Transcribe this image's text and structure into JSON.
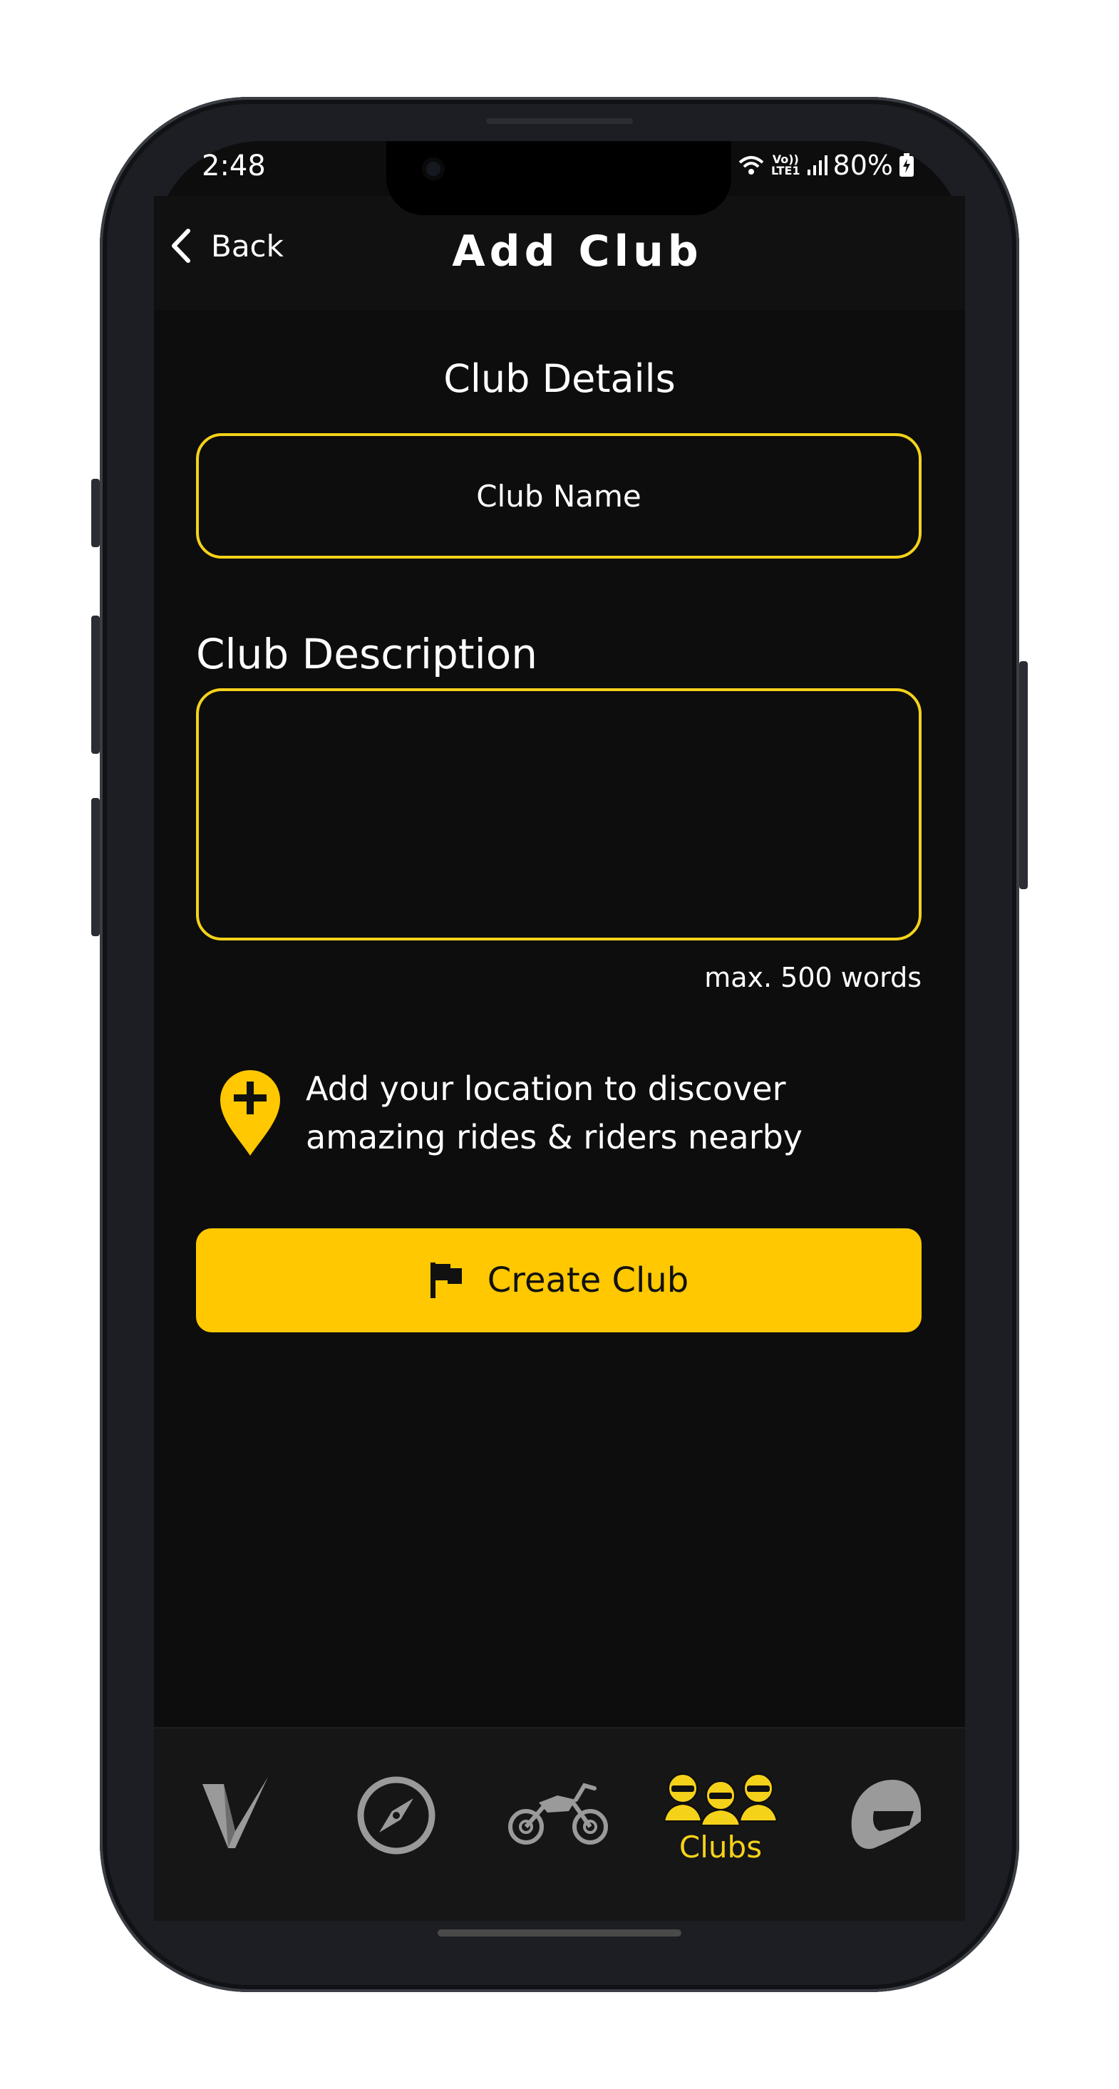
{
  "status_bar": {
    "time": "2:48",
    "network_top": "Vo))",
    "network_bottom": "LTE1",
    "battery": "80%"
  },
  "header": {
    "back_label": "Back",
    "title": "Add Club"
  },
  "form": {
    "section_title": "Club Details",
    "club_name_placeholder": "Club Name",
    "description_label": "Club Description",
    "description_value": "",
    "word_limit": "max. 500 words"
  },
  "location": {
    "text": "Add your location to discover amazing rides & riders nearby"
  },
  "create_button": {
    "label": "Create Club"
  },
  "tabs": [
    {
      "icon": "logo-v-icon",
      "label": ""
    },
    {
      "icon": "compass-icon",
      "label": ""
    },
    {
      "icon": "motorcycle-icon",
      "label": ""
    },
    {
      "icon": "riders-group-icon",
      "label": "Clubs",
      "active": true
    },
    {
      "icon": "helmet-icon",
      "label": ""
    }
  ],
  "colors": {
    "accent": "#ffc800",
    "field_border": "#f5d21a",
    "background": "#0d0d0d",
    "inactive_icon": "#9a9a9a"
  }
}
